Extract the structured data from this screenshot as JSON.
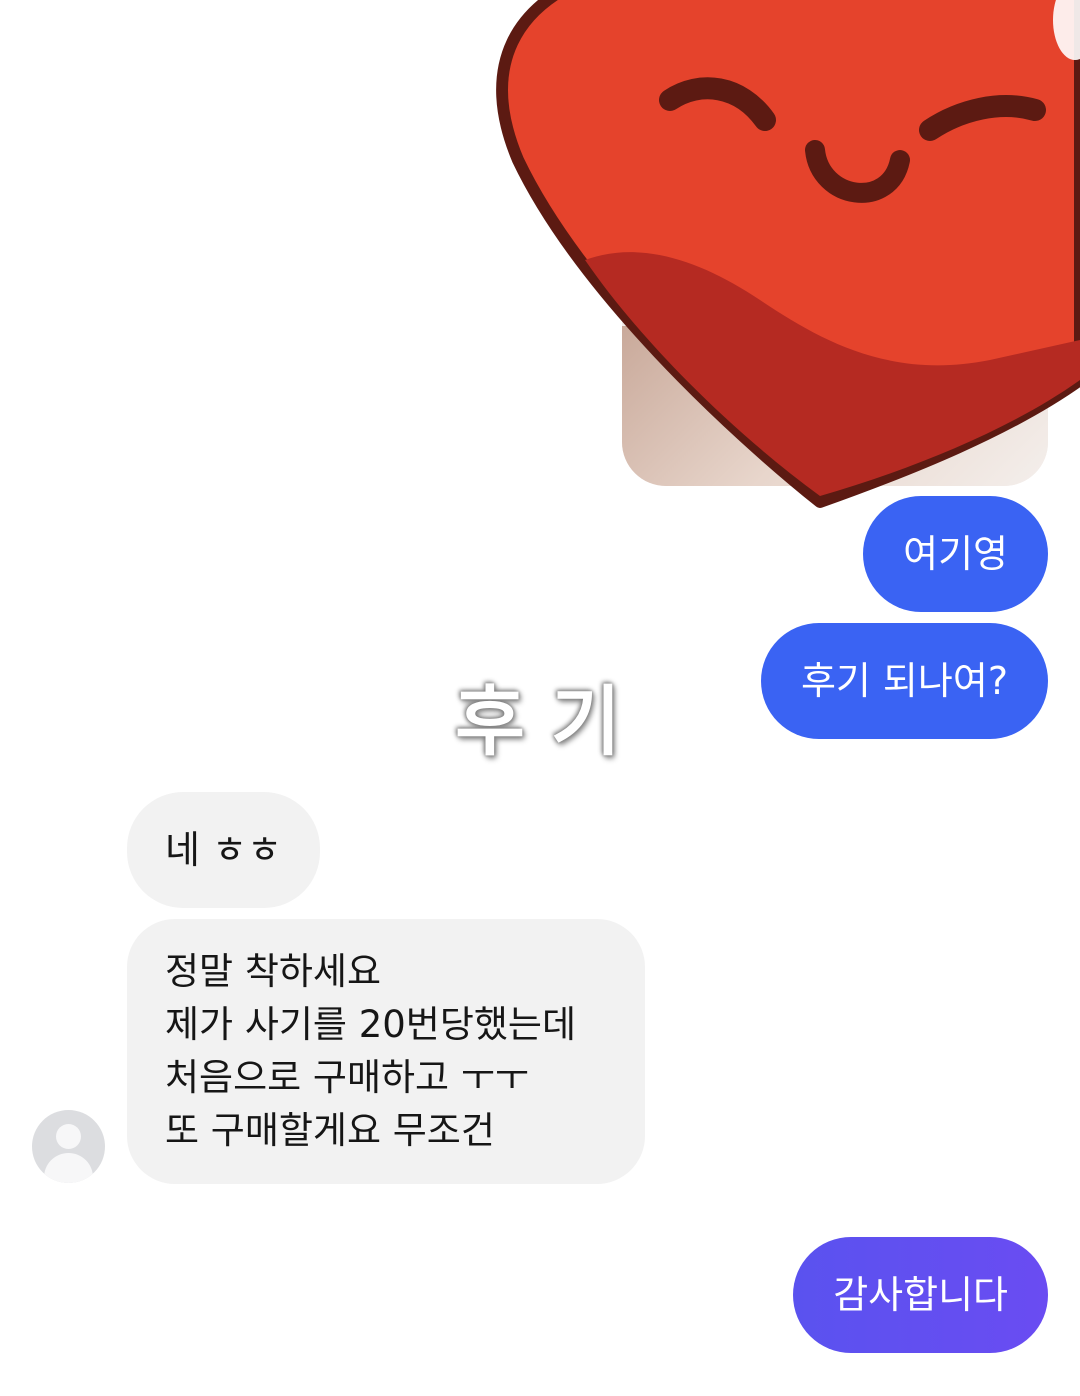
{
  "conversation": {
    "messages": [
      {
        "side": "sent",
        "text": "여기영"
      },
      {
        "side": "sent",
        "text": "후기 되나여?"
      },
      {
        "side": "received",
        "text": "네 ㅎㅎ"
      },
      {
        "side": "received",
        "text": "정말 착하세요\n제가 사기를 20번당했는데\n처음으로 구매하고 ㅜㅜ\n또 구매할게요 무조건"
      },
      {
        "side": "sent",
        "text": "감사합니다"
      }
    ],
    "sent_image": {
      "sticker_icon": "heart-face-sticker-icon"
    },
    "avatar_icon": "default-user-icon"
  },
  "overlay": {
    "caption": "후기"
  },
  "colors": {
    "sent_bubble": "#3a63f3",
    "sent_bubble_last": "#5a52ef",
    "received_bubble": "#f2f2f2",
    "sticker_red": "#e5432c",
    "sticker_dark_red": "#b52a22",
    "sticker_outline": "#5c1a12"
  }
}
